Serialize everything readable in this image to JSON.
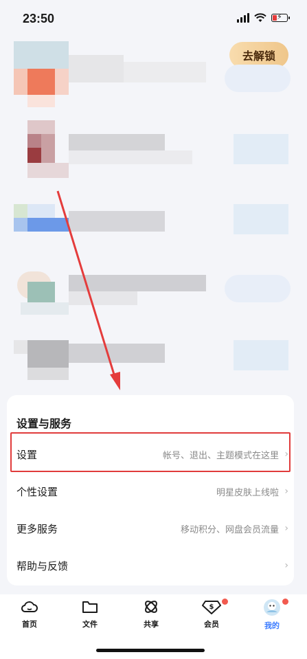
{
  "status_bar": {
    "time": "23:50"
  },
  "unlock_button": {
    "label": "去解锁"
  },
  "settings": {
    "title": "设置与服务",
    "items": [
      {
        "label": "设置",
        "desc": "帐号、退出、主题模式在这里"
      },
      {
        "label": "个性设置",
        "desc": "明星皮肤上线啦"
      },
      {
        "label": "更多服务",
        "desc": "移动积分、网盘会员流量"
      },
      {
        "label": "帮助与反馈",
        "desc": ""
      }
    ]
  },
  "tabs": [
    {
      "label": "首页",
      "icon": "cloud-icon",
      "active": false
    },
    {
      "label": "文件",
      "icon": "folder-icon",
      "active": false
    },
    {
      "label": "共享",
      "icon": "share-icon",
      "active": false
    },
    {
      "label": "会员",
      "icon": "vip-diamond-icon",
      "active": false,
      "badge": true
    },
    {
      "label": "我的",
      "icon": "avatar-icon",
      "active": true,
      "badge": true
    }
  ],
  "colors": {
    "accent": "#3b7bff",
    "highlight": "#e03b3b",
    "arrow": "#e43c3c"
  }
}
